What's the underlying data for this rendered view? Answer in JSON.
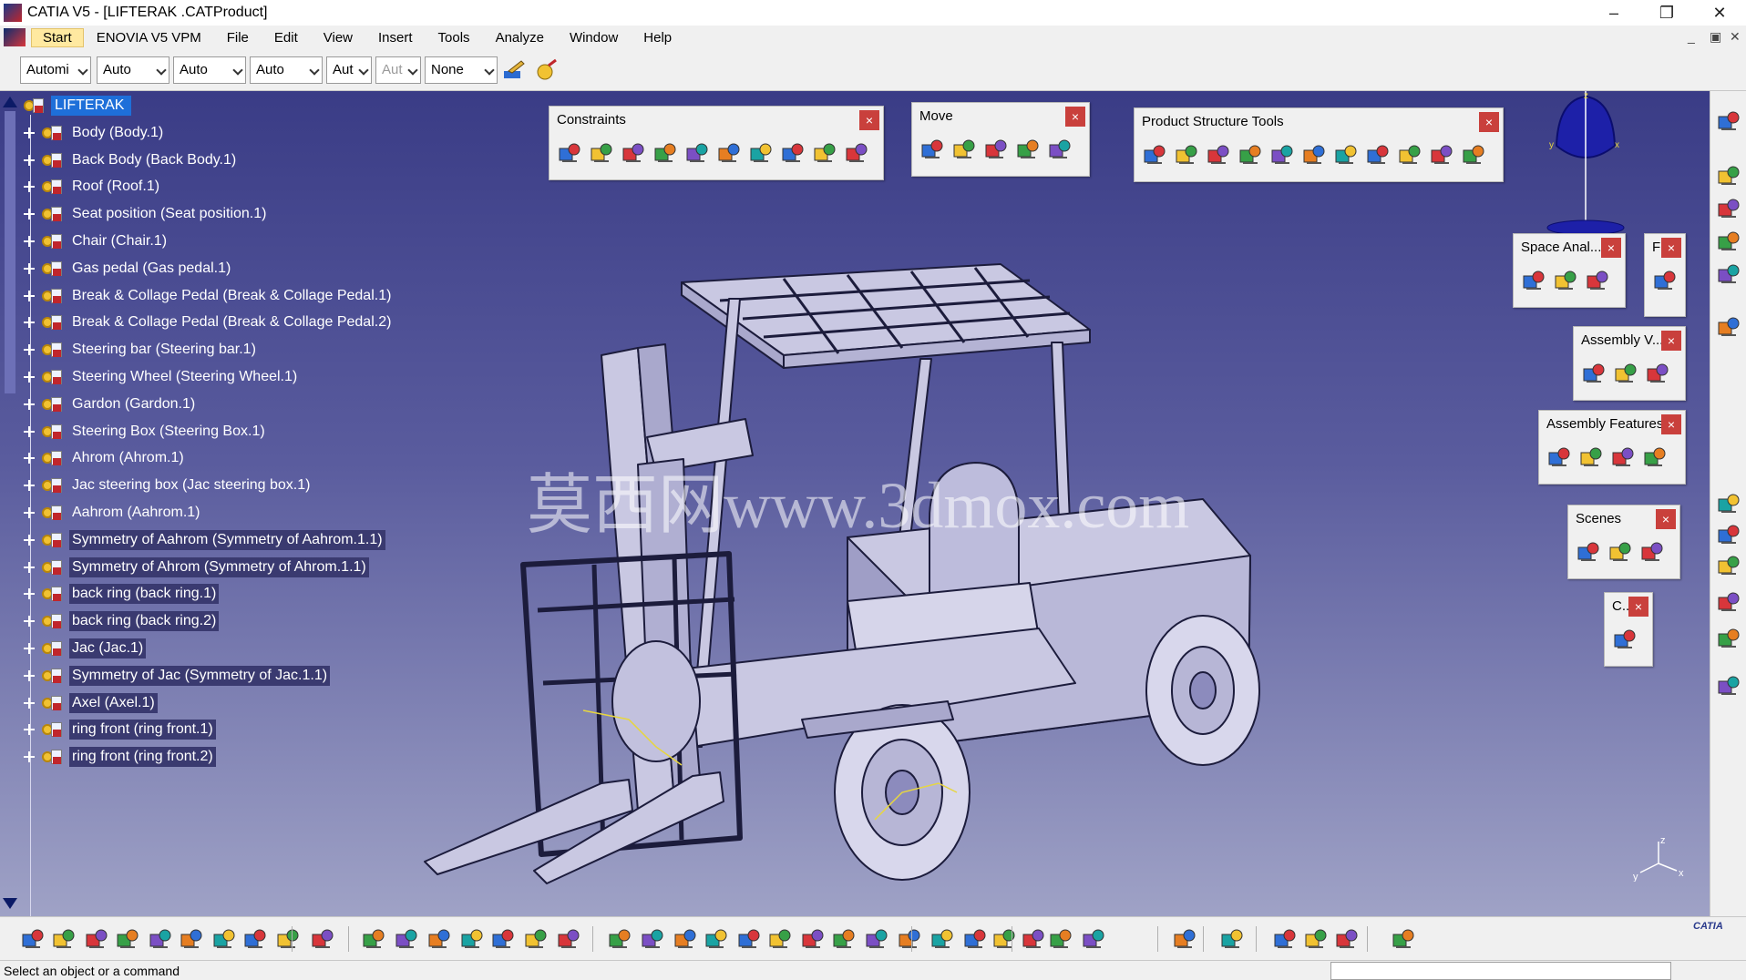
{
  "window": {
    "title": "CATIA V5 - [LIFTERAK     .CATProduct]",
    "minimize": "–",
    "restore": "❐",
    "close": "✕"
  },
  "menu": {
    "items": [
      "Start",
      "ENOVIA V5 VPM",
      "File",
      "Edit",
      "View",
      "Insert",
      "Tools",
      "Analyze",
      "Window",
      "Help"
    ],
    "mdi_minimize": "_",
    "mdi_restore": "▣",
    "mdi_close": "✕"
  },
  "options_toolbar": {
    "combos": [
      "Automi",
      "Auto",
      "Auto",
      "Auto",
      "Aut",
      "Aut",
      "None"
    ]
  },
  "tree": {
    "root": "LIFTERAK",
    "items": [
      "Body (Body.1)",
      "Back Body (Back Body.1)",
      "Roof (Roof.1)",
      "Seat position (Seat position.1)",
      "Chair (Chair.1)",
      "Gas pedal (Gas pedal.1)",
      "Break & Collage Pedal (Break & Collage Pedal.1)",
      "Break & Collage Pedal (Break & Collage Pedal.2)",
      "Steering bar (Steering bar.1)",
      "Steering Wheel (Steering Wheel.1)",
      "Gardon (Gardon.1)",
      "Steering Box (Steering Box.1)",
      "Ahrom (Ahrom.1)",
      "Jac steering box (Jac steering box.1)",
      "Aahrom (Aahrom.1)",
      "Symmetry of Aahrom (Symmetry of Aahrom.1.1)",
      "Symmetry of Ahrom (Symmetry of Ahrom.1.1)",
      "back ring (back ring.1)",
      "back ring (back ring.2)",
      "Jac (Jac.1)",
      "Symmetry of Jac (Symmetry of Jac.1.1)",
      "Axel (Axel.1)",
      "ring front (ring front.1)",
      "ring front (ring front.2)"
    ]
  },
  "toolbars": {
    "constraints": "Constraints",
    "move": "Move",
    "product_structure": "Product Structure Tools",
    "space_analysis": "Space Anal...",
    "f_bar": "F",
    "assembly_v": "Assembly V...",
    "assembly_features": "Assembly Features",
    "scenes": "Scenes",
    "c_bar": "C...",
    "close_glyph": "×"
  },
  "viewport": {
    "watermark": "莫西网www.3dmox.com",
    "compass_z": "z",
    "compass_x": "x",
    "compass_y": "y",
    "axis_z": "z",
    "axis_x": "x",
    "axis_y": "y"
  },
  "catia_logo": "CATIA",
  "status": {
    "message": "Select an object or a command"
  },
  "colors": {
    "viewport_top": "#3a3c86",
    "viewport_bottom": "#9fa2c6",
    "tree_selection": "#1e6fd9",
    "close_button": "#c9403c",
    "model_fill": "#c9c8e2",
    "model_stroke": "#1c1c3c"
  }
}
